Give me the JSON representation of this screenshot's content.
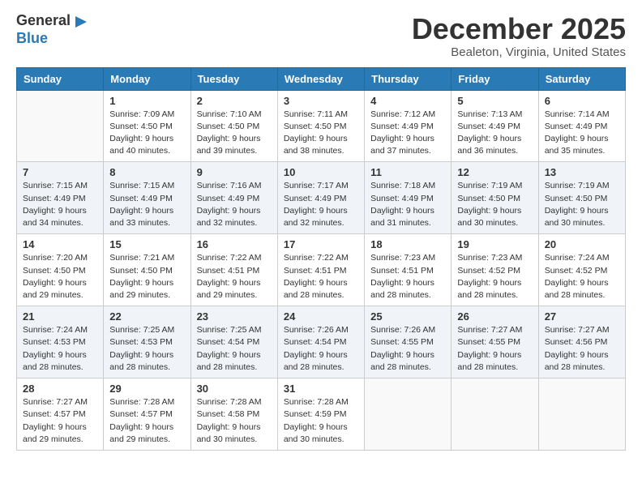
{
  "header": {
    "logo_general": "General",
    "logo_blue": "Blue",
    "month_title": "December 2025",
    "location": "Bealeton, Virginia, United States"
  },
  "days_of_week": [
    "Sunday",
    "Monday",
    "Tuesday",
    "Wednesday",
    "Thursday",
    "Friday",
    "Saturday"
  ],
  "weeks": [
    [
      {
        "day": "",
        "sunrise": "",
        "sunset": "",
        "daylight": ""
      },
      {
        "day": "1",
        "sunrise": "Sunrise: 7:09 AM",
        "sunset": "Sunset: 4:50 PM",
        "daylight": "Daylight: 9 hours and 40 minutes."
      },
      {
        "day": "2",
        "sunrise": "Sunrise: 7:10 AM",
        "sunset": "Sunset: 4:50 PM",
        "daylight": "Daylight: 9 hours and 39 minutes."
      },
      {
        "day": "3",
        "sunrise": "Sunrise: 7:11 AM",
        "sunset": "Sunset: 4:50 PM",
        "daylight": "Daylight: 9 hours and 38 minutes."
      },
      {
        "day": "4",
        "sunrise": "Sunrise: 7:12 AM",
        "sunset": "Sunset: 4:49 PM",
        "daylight": "Daylight: 9 hours and 37 minutes."
      },
      {
        "day": "5",
        "sunrise": "Sunrise: 7:13 AM",
        "sunset": "Sunset: 4:49 PM",
        "daylight": "Daylight: 9 hours and 36 minutes."
      },
      {
        "day": "6",
        "sunrise": "Sunrise: 7:14 AM",
        "sunset": "Sunset: 4:49 PM",
        "daylight": "Daylight: 9 hours and 35 minutes."
      }
    ],
    [
      {
        "day": "7",
        "sunrise": "Sunrise: 7:15 AM",
        "sunset": "Sunset: 4:49 PM",
        "daylight": "Daylight: 9 hours and 34 minutes."
      },
      {
        "day": "8",
        "sunrise": "Sunrise: 7:15 AM",
        "sunset": "Sunset: 4:49 PM",
        "daylight": "Daylight: 9 hours and 33 minutes."
      },
      {
        "day": "9",
        "sunrise": "Sunrise: 7:16 AM",
        "sunset": "Sunset: 4:49 PM",
        "daylight": "Daylight: 9 hours and 32 minutes."
      },
      {
        "day": "10",
        "sunrise": "Sunrise: 7:17 AM",
        "sunset": "Sunset: 4:49 PM",
        "daylight": "Daylight: 9 hours and 32 minutes."
      },
      {
        "day": "11",
        "sunrise": "Sunrise: 7:18 AM",
        "sunset": "Sunset: 4:49 PM",
        "daylight": "Daylight: 9 hours and 31 minutes."
      },
      {
        "day": "12",
        "sunrise": "Sunrise: 7:19 AM",
        "sunset": "Sunset: 4:50 PM",
        "daylight": "Daylight: 9 hours and 30 minutes."
      },
      {
        "day": "13",
        "sunrise": "Sunrise: 7:19 AM",
        "sunset": "Sunset: 4:50 PM",
        "daylight": "Daylight: 9 hours and 30 minutes."
      }
    ],
    [
      {
        "day": "14",
        "sunrise": "Sunrise: 7:20 AM",
        "sunset": "Sunset: 4:50 PM",
        "daylight": "Daylight: 9 hours and 29 minutes."
      },
      {
        "day": "15",
        "sunrise": "Sunrise: 7:21 AM",
        "sunset": "Sunset: 4:50 PM",
        "daylight": "Daylight: 9 hours and 29 minutes."
      },
      {
        "day": "16",
        "sunrise": "Sunrise: 7:22 AM",
        "sunset": "Sunset: 4:51 PM",
        "daylight": "Daylight: 9 hours and 29 minutes."
      },
      {
        "day": "17",
        "sunrise": "Sunrise: 7:22 AM",
        "sunset": "Sunset: 4:51 PM",
        "daylight": "Daylight: 9 hours and 28 minutes."
      },
      {
        "day": "18",
        "sunrise": "Sunrise: 7:23 AM",
        "sunset": "Sunset: 4:51 PM",
        "daylight": "Daylight: 9 hours and 28 minutes."
      },
      {
        "day": "19",
        "sunrise": "Sunrise: 7:23 AM",
        "sunset": "Sunset: 4:52 PM",
        "daylight": "Daylight: 9 hours and 28 minutes."
      },
      {
        "day": "20",
        "sunrise": "Sunrise: 7:24 AM",
        "sunset": "Sunset: 4:52 PM",
        "daylight": "Daylight: 9 hours and 28 minutes."
      }
    ],
    [
      {
        "day": "21",
        "sunrise": "Sunrise: 7:24 AM",
        "sunset": "Sunset: 4:53 PM",
        "daylight": "Daylight: 9 hours and 28 minutes."
      },
      {
        "day": "22",
        "sunrise": "Sunrise: 7:25 AM",
        "sunset": "Sunset: 4:53 PM",
        "daylight": "Daylight: 9 hours and 28 minutes."
      },
      {
        "day": "23",
        "sunrise": "Sunrise: 7:25 AM",
        "sunset": "Sunset: 4:54 PM",
        "daylight": "Daylight: 9 hours and 28 minutes."
      },
      {
        "day": "24",
        "sunrise": "Sunrise: 7:26 AM",
        "sunset": "Sunset: 4:54 PM",
        "daylight": "Daylight: 9 hours and 28 minutes."
      },
      {
        "day": "25",
        "sunrise": "Sunrise: 7:26 AM",
        "sunset": "Sunset: 4:55 PM",
        "daylight": "Daylight: 9 hours and 28 minutes."
      },
      {
        "day": "26",
        "sunrise": "Sunrise: 7:27 AM",
        "sunset": "Sunset: 4:55 PM",
        "daylight": "Daylight: 9 hours and 28 minutes."
      },
      {
        "day": "27",
        "sunrise": "Sunrise: 7:27 AM",
        "sunset": "Sunset: 4:56 PM",
        "daylight": "Daylight: 9 hours and 28 minutes."
      }
    ],
    [
      {
        "day": "28",
        "sunrise": "Sunrise: 7:27 AM",
        "sunset": "Sunset: 4:57 PM",
        "daylight": "Daylight: 9 hours and 29 minutes."
      },
      {
        "day": "29",
        "sunrise": "Sunrise: 7:28 AM",
        "sunset": "Sunset: 4:57 PM",
        "daylight": "Daylight: 9 hours and 29 minutes."
      },
      {
        "day": "30",
        "sunrise": "Sunrise: 7:28 AM",
        "sunset": "Sunset: 4:58 PM",
        "daylight": "Daylight: 9 hours and 30 minutes."
      },
      {
        "day": "31",
        "sunrise": "Sunrise: 7:28 AM",
        "sunset": "Sunset: 4:59 PM",
        "daylight": "Daylight: 9 hours and 30 minutes."
      },
      {
        "day": "",
        "sunrise": "",
        "sunset": "",
        "daylight": ""
      },
      {
        "day": "",
        "sunrise": "",
        "sunset": "",
        "daylight": ""
      },
      {
        "day": "",
        "sunrise": "",
        "sunset": "",
        "daylight": ""
      }
    ]
  ]
}
